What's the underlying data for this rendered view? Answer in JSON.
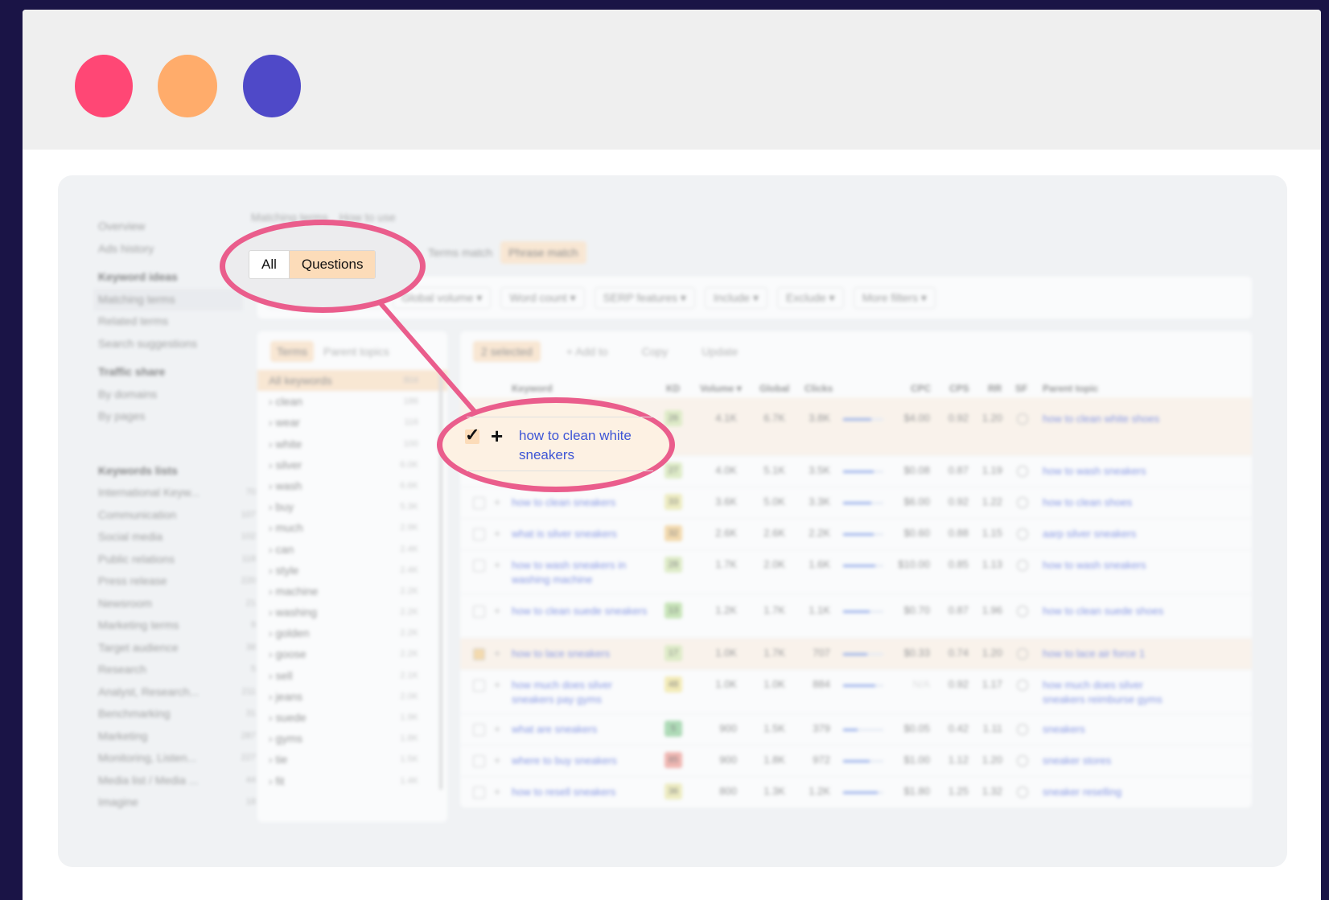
{
  "window": {
    "controls": [
      "close-dot",
      "minimize-dot",
      "maximize-dot"
    ],
    "colors": {
      "close": "#ff4775",
      "minimize": "#ffac6b",
      "maximize": "#4f49c8",
      "accent": "#ea5d8c",
      "highlight": "#fcdcb9",
      "link": "#3d55d6"
    }
  },
  "callouts": {
    "tabs": {
      "all": "All",
      "questions": "Questions"
    },
    "row": {
      "keyword": "how to clean white sneakers"
    }
  }
}
